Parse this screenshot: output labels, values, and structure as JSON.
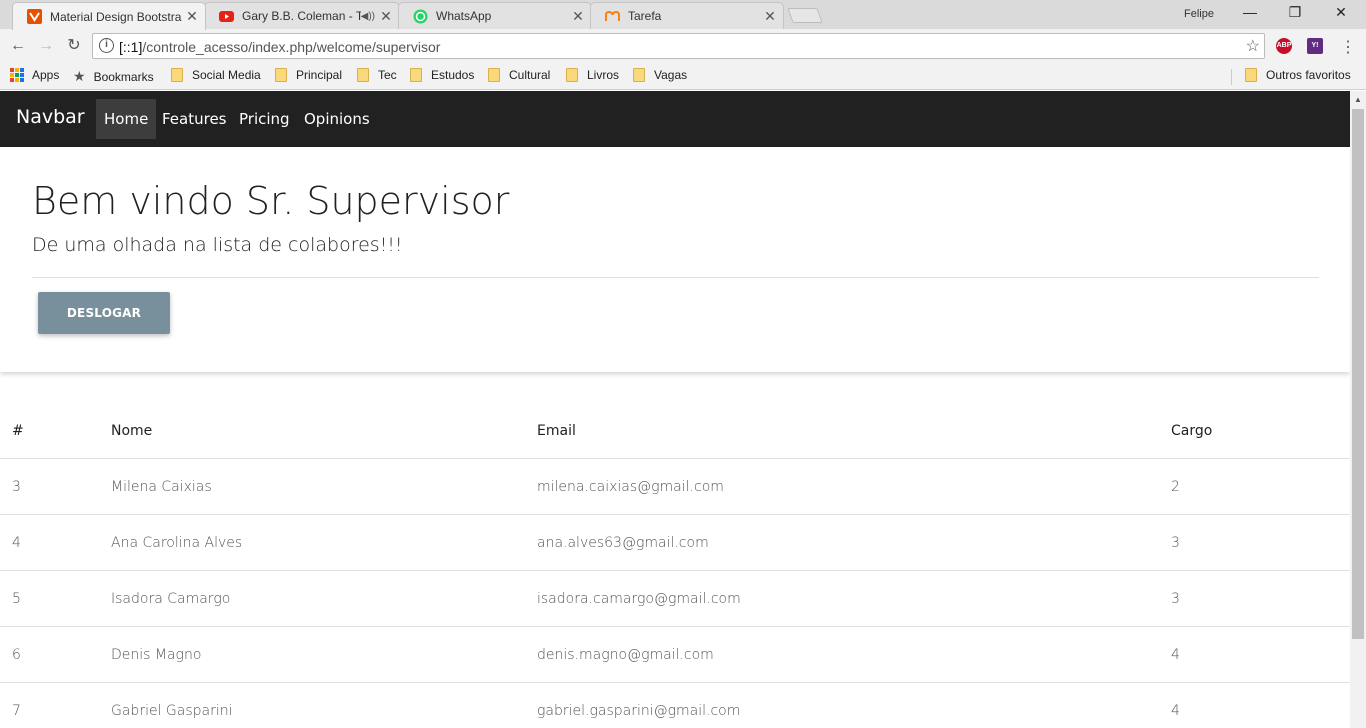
{
  "browser": {
    "tabs": [
      {
        "title": "Material Design Bootstra",
        "favicon": "mdb-icon",
        "active": true,
        "audio": false
      },
      {
        "title": "Gary B.B. Coleman - T",
        "favicon": "youtube-icon",
        "active": false,
        "audio": true
      },
      {
        "title": "WhatsApp",
        "favicon": "whatsapp-icon",
        "active": false,
        "audio": false
      },
      {
        "title": "Tarefa",
        "favicon": "moodle-icon",
        "active": false,
        "audio": false
      }
    ],
    "profile_name": "Felipe",
    "url_host": "[::1]",
    "url_path": "/controle_acesso/index.php/welcome/supervisor",
    "extensions": [
      {
        "name": "adblock-plus-icon",
        "label": "ABP",
        "color": "#c70d2c"
      },
      {
        "name": "yslow-icon",
        "label": "Y!",
        "color": "#5f2c82"
      }
    ],
    "bookmarks": {
      "apps_label": "Apps",
      "bookmarks_label": "Bookmarks",
      "folders": [
        "Social Media",
        "Principal",
        "Tec",
        "Estudos",
        "Cultural",
        "Livros",
        "Vagas"
      ],
      "other_label": "Outros favoritos"
    }
  },
  "navbar": {
    "brand": "Navbar",
    "links": [
      "Home",
      "Features",
      "Pricing",
      "Opinions"
    ],
    "active_link": "Home",
    "background": "#212121"
  },
  "jumbotron": {
    "title": "Bem vindo Sr. Supervisor",
    "subtitle": "De uma olhada na lista de colabores!!!",
    "logout_label": "DESLOGAR",
    "button_color": "#78909c"
  },
  "table": {
    "headers": [
      "#",
      "Nome",
      "Email",
      "Cargo"
    ],
    "rows": [
      [
        "3",
        "Milena Caixias",
        "milena.caixias@gmail.com",
        "2"
      ],
      [
        "4",
        "Ana Carolina Alves",
        "ana.alves63@gmail.com",
        "3"
      ],
      [
        "5",
        "Isadora Camargo",
        "isadora.camargo@gmail.com",
        "3"
      ],
      [
        "6",
        "Denis Magno",
        "denis.magno@gmail.com",
        "4"
      ],
      [
        "7",
        "Gabriel Gasparini",
        "gabriel.gasparini@gmail.com",
        "4"
      ]
    ]
  }
}
